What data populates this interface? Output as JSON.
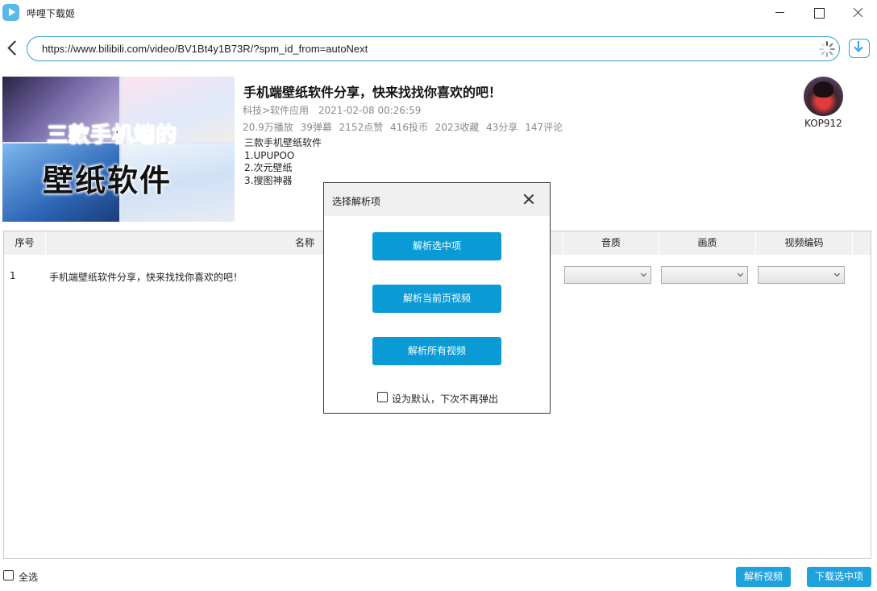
{
  "window": {
    "title": "哔哩下载姬"
  },
  "address_bar": {
    "url": "https://www.bilibili.com/video/BV1Bt4y1B73R/?spm_id_from=autoNext"
  },
  "video": {
    "thumbnail_text_line1": "三款手机端的",
    "thumbnail_text_line2": "壁纸软件",
    "title": "手机端壁纸软件分享，快来找找你喜欢的吧！",
    "category": "科技>软件应用",
    "date": "2021-02-08 00:26:59",
    "stats": [
      "20.9万播放",
      "39弹幕",
      "2152点赞",
      "416投币",
      "2023收藏",
      "43分享",
      "147评论"
    ],
    "description": [
      "三款手机壁纸软件",
      "1.UPUPOO",
      "2.次元壁纸",
      "3.搜图神器"
    ],
    "uploader": "KOP912"
  },
  "table": {
    "columns": [
      "序号",
      "名称",
      "音质",
      "画质",
      "视频编码"
    ],
    "rows": [
      {
        "index": "1",
        "name": "手机端壁纸软件分享，快来找找你喜欢的吧！",
        "audio": "",
        "quality": "",
        "codec": ""
      }
    ]
  },
  "footer": {
    "select_all": "全选",
    "parse_video": "解析视频",
    "download_selected": "下载选中项"
  },
  "dialog": {
    "title": "选择解析项",
    "btn_parse_selected": "解析选中项",
    "btn_parse_current": "解析当前页视频",
    "btn_parse_all": "解析所有视频",
    "default_checkbox": "设为默认，下次不再弹出"
  },
  "colors": {
    "accent": "#1fa2dc",
    "url_border": "#2f9fd6"
  }
}
